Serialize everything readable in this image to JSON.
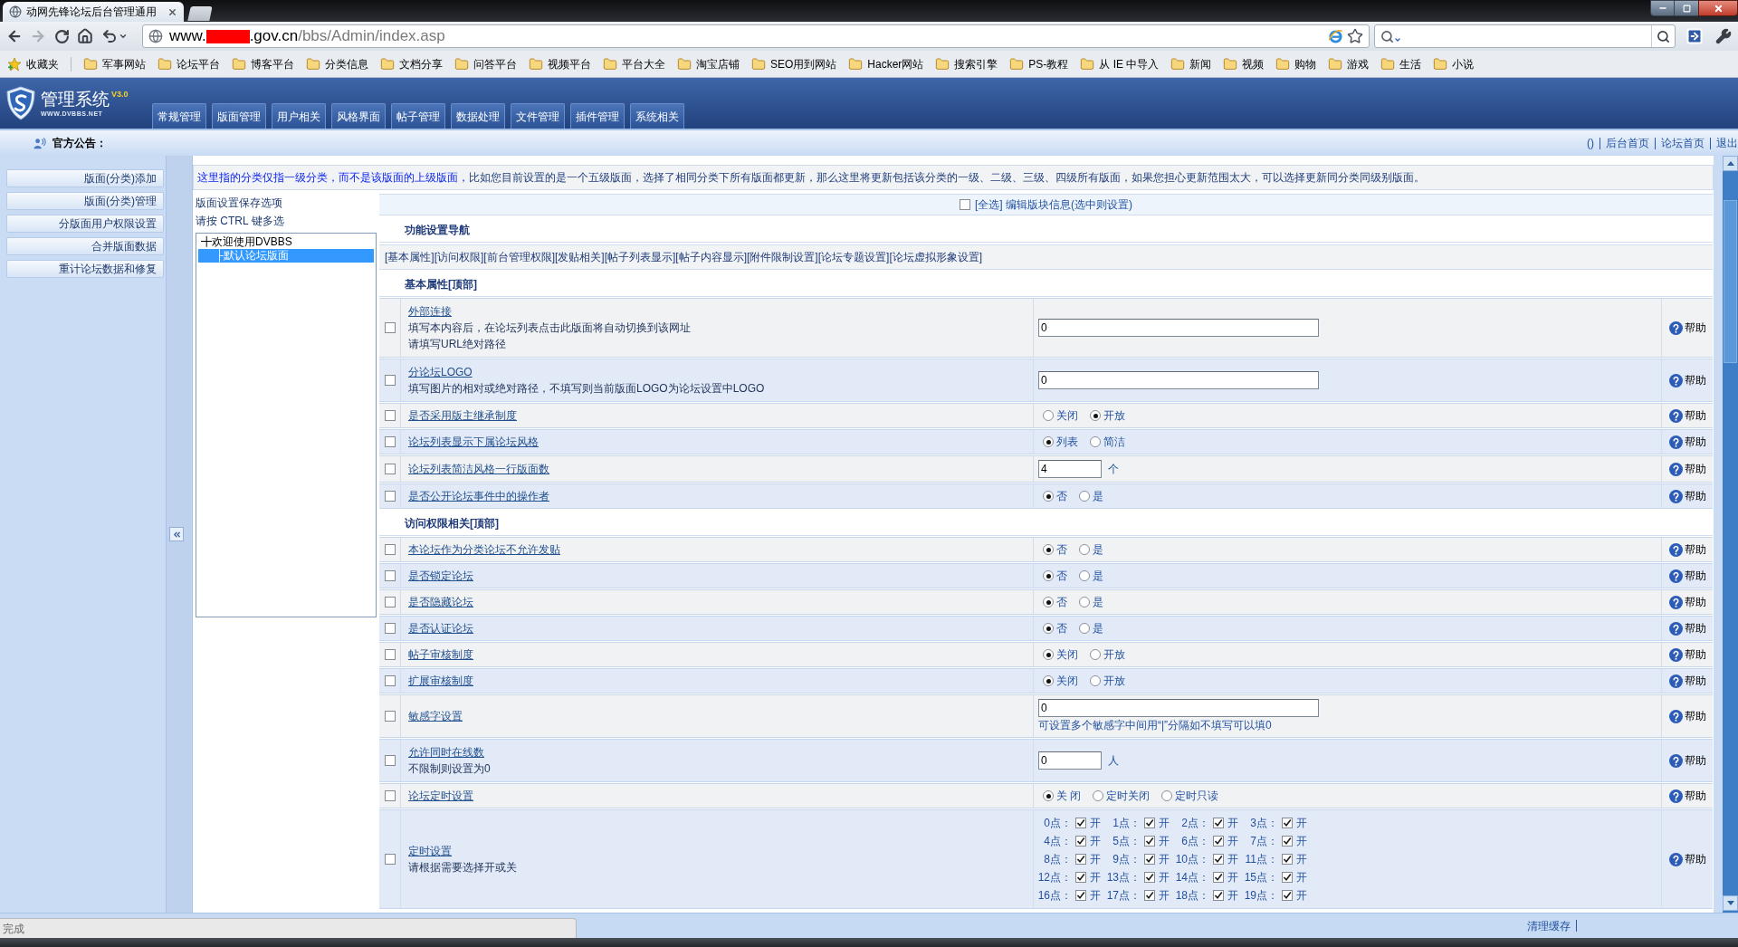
{
  "browser": {
    "tab_title": "动网先锋论坛后台管理通用",
    "url": {
      "host_prefix": "www.",
      "host_suffix": ".gov.cn",
      "path": "/bbs/Admin/index.asp"
    },
    "bookmarks": [
      {
        "kind": "favorites",
        "label": "收藏夹"
      },
      {
        "kind": "folder",
        "label": "军事网站"
      },
      {
        "kind": "folder",
        "label": "论坛平台"
      },
      {
        "kind": "folder",
        "label": "博客平台"
      },
      {
        "kind": "folder",
        "label": "分类信息"
      },
      {
        "kind": "folder",
        "label": "文档分享"
      },
      {
        "kind": "folder",
        "label": "问答平台"
      },
      {
        "kind": "folder",
        "label": "视频平台"
      },
      {
        "kind": "folder",
        "label": "平台大全"
      },
      {
        "kind": "folder",
        "label": "淘宝店铺"
      },
      {
        "kind": "folder",
        "label": "SEO用到网站"
      },
      {
        "kind": "folder",
        "label": "Hacker网站"
      },
      {
        "kind": "folder",
        "label": "搜索引擎"
      },
      {
        "kind": "folder",
        "label": "PS-教程"
      },
      {
        "kind": "folder",
        "label": "从 IE 中导入"
      },
      {
        "kind": "folder",
        "label": "新闻"
      },
      {
        "kind": "folder",
        "label": "视频"
      },
      {
        "kind": "folder",
        "label": "购物"
      },
      {
        "kind": "folder",
        "label": "游戏"
      },
      {
        "kind": "folder",
        "label": "生活"
      },
      {
        "kind": "folder",
        "label": "小说"
      }
    ]
  },
  "header": {
    "logo": {
      "title": "管理系统",
      "version": "V3.0",
      "site": "WWW.DVBBS.NET"
    },
    "nav": [
      "常规管理",
      "版面管理",
      "用户相关",
      "风格界面",
      "帖子管理",
      "数据处理",
      "文件管理",
      "插件管理",
      "系统相关"
    ]
  },
  "announcement": {
    "label": "官方公告：",
    "links": [
      "()",
      "后台首页",
      "论坛首页",
      "退出"
    ]
  },
  "sidebar": {
    "items": [
      "版面(分类)添加",
      "版面(分类)管理",
      "分版面用户权限设置",
      "合并版面数据",
      "重计论坛数据和修复"
    ]
  },
  "notice": {
    "emphasis": "这里指的分类仅指一级分类，而不是该版面的上级版面，",
    "text": "比如您目前设置的是一个五级版面，选择了相同分类下所有版面都更新，那么这里将更新包括该分类的一级、二级、三级、四级所有版面，如果您担心更新范围太大，可以选择更新同分类同级别版面。"
  },
  "board_panel": {
    "title": "版面设置保存选项",
    "hint": "请按 CTRL 键多选",
    "boards": [
      {
        "label": "╋欢迎使用DVBBS",
        "selected": false,
        "children": [
          {
            "label": "├默认论坛版面",
            "selected": true
          }
        ]
      }
    ]
  },
  "form": {
    "select_all": {
      "checked": false,
      "label": "[全选] 编辑版块信息(选中则设置)"
    },
    "nav_title": "功能设置导航",
    "nav_links": [
      "[基本属性]",
      "[访问权限]",
      "[前台管理权限]",
      "[发贴相关]",
      "[帖子列表显示]",
      "[帖子内容显示]",
      "[附件限制设置]",
      "[论坛专题设置]",
      "[论坛虚拟形象设置]"
    ],
    "sections": [
      {
        "title": "基本属性[顶部]",
        "rows": [
          {
            "kind": "text",
            "checked": false,
            "label": "外部连接",
            "notes": [
              "填写本内容后，在论坛列表点击此版面将自动切换到该网址",
              "请填写URL绝对路径"
            ],
            "value": "0",
            "help": "帮助"
          },
          {
            "kind": "text",
            "checked": false,
            "label": "分论坛LOGO",
            "notes": [
              "填写图片的相对或绝对路径，不填写则当前版面LOGO为论坛设置中LOGO"
            ],
            "value": "0",
            "help": "帮助"
          },
          {
            "kind": "radio",
            "checked": false,
            "label": "是否采用版主继承制度",
            "options": [
              {
                "label": "关闭",
                "selected": false
              },
              {
                "label": "开放",
                "selected": true
              }
            ],
            "help": "帮助"
          },
          {
            "kind": "radio",
            "checked": false,
            "label": "论坛列表显示下属论坛风格",
            "options": [
              {
                "label": "列表",
                "selected": true
              },
              {
                "label": "简洁",
                "selected": false
              }
            ],
            "help": "帮助"
          },
          {
            "kind": "number",
            "checked": false,
            "label": "论坛列表简洁风格一行版面数",
            "value": "4",
            "unit": "个",
            "help": "帮助"
          },
          {
            "kind": "radio",
            "checked": false,
            "label": "是否公开论坛事件中的操作者",
            "options": [
              {
                "label": "否",
                "selected": true
              },
              {
                "label": "是",
                "selected": false
              }
            ],
            "help": "帮助"
          }
        ]
      },
      {
        "title": "访问权限相关[顶部]",
        "rows": [
          {
            "kind": "radio",
            "checked": false,
            "label": "本论坛作为分类论坛不允许发贴",
            "options": [
              {
                "label": "否",
                "selected": true
              },
              {
                "label": "是",
                "selected": false
              }
            ],
            "help": "帮助"
          },
          {
            "kind": "radio",
            "checked": false,
            "label": "是否锁定论坛",
            "options": [
              {
                "label": "否",
                "selected": true
              },
              {
                "label": "是",
                "selected": false
              }
            ],
            "help": "帮助"
          },
          {
            "kind": "radio",
            "checked": false,
            "label": "是否隐藏论坛",
            "options": [
              {
                "label": "否",
                "selected": true
              },
              {
                "label": "是",
                "selected": false
              }
            ],
            "help": "帮助"
          },
          {
            "kind": "radio",
            "checked": false,
            "label": "是否认证论坛",
            "options": [
              {
                "label": "否",
                "selected": true
              },
              {
                "label": "是",
                "selected": false
              }
            ],
            "help": "帮助"
          },
          {
            "kind": "radio",
            "checked": false,
            "label": "帖子审核制度",
            "options": [
              {
                "label": "关闭",
                "selected": true
              },
              {
                "label": "开放",
                "selected": false
              }
            ],
            "help": "帮助"
          },
          {
            "kind": "radio",
            "checked": false,
            "label": "扩展审核制度",
            "options": [
              {
                "label": "关闭",
                "selected": true
              },
              {
                "label": "开放",
                "selected": false
              }
            ],
            "help": "帮助"
          },
          {
            "kind": "text",
            "checked": false,
            "label": "敏感字设置",
            "value": "0",
            "field_note": "可设置多个敏感字中间用“|”分隔如不填写可以填0",
            "help": "帮助"
          },
          {
            "kind": "number",
            "checked": false,
            "label": "允许同时在线数",
            "notes": [
              "不限制则设置为0"
            ],
            "value": "0",
            "unit": "人",
            "help": "帮助"
          },
          {
            "kind": "radio",
            "checked": false,
            "label": "论坛定时设置",
            "options": [
              {
                "label": "关 闭",
                "selected": true
              },
              {
                "label": "定时关闭",
                "selected": false
              },
              {
                "label": "定时只读",
                "selected": false
              }
            ],
            "help": "帮助"
          },
          {
            "kind": "schedule",
            "checked": false,
            "label": "定时设置",
            "notes": [
              "请根据需要选择开或关"
            ],
            "hours": [
              {
                "label": "0点：",
                "option": "开",
                "checked": true
              },
              {
                "label": "1点：",
                "option": "开",
                "checked": true
              },
              {
                "label": "2点：",
                "option": "开",
                "checked": true
              },
              {
                "label": "3点：",
                "option": "开",
                "checked": true
              },
              {
                "label": "4点：",
                "option": "开",
                "checked": true
              },
              {
                "label": "5点：",
                "option": "开",
                "checked": true
              },
              {
                "label": "6点：",
                "option": "开",
                "checked": true
              },
              {
                "label": "7点：",
                "option": "开",
                "checked": true
              },
              {
                "label": "8点：",
                "option": "开",
                "checked": true
              },
              {
                "label": "9点：",
                "option": "开",
                "checked": true
              },
              {
                "label": "10点：",
                "option": "开",
                "checked": true
              },
              {
                "label": "11点：",
                "option": "开",
                "checked": true
              },
              {
                "label": "12点：",
                "option": "开",
                "checked": true
              },
              {
                "label": "13点：",
                "option": "开",
                "checked": true
              },
              {
                "label": "14点：",
                "option": "开",
                "checked": true
              },
              {
                "label": "15点：",
                "option": "开",
                "checked": true
              },
              {
                "label": "16点：",
                "option": "开",
                "checked": true
              },
              {
                "label": "17点：",
                "option": "开",
                "checked": true
              },
              {
                "label": "18点：",
                "option": "开",
                "checked": true
              },
              {
                "label": "19点：",
                "option": "开",
                "checked": true
              }
            ],
            "help": "帮助"
          }
        ]
      }
    ]
  },
  "status_bar": {
    "status": "完成",
    "links": [
      "清理缓存"
    ]
  }
}
